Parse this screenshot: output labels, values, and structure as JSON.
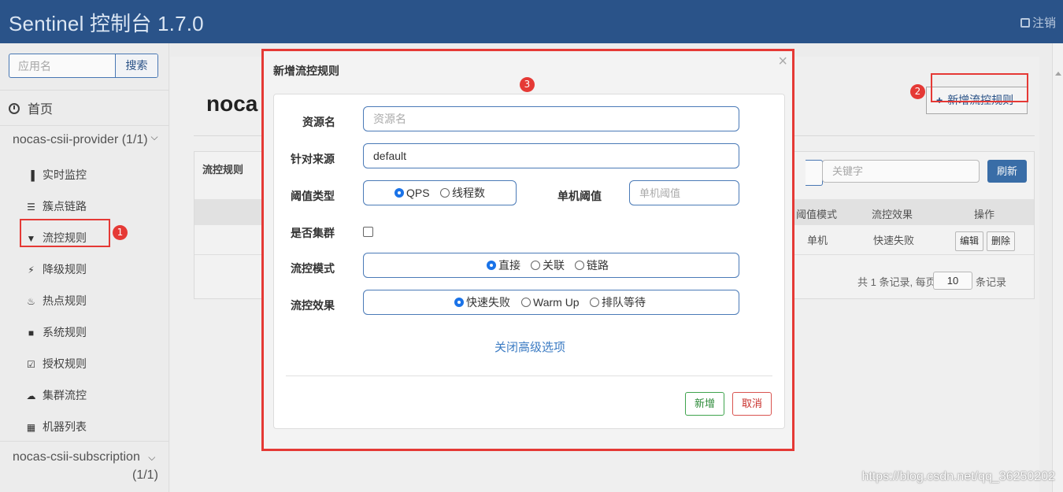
{
  "header": {
    "title": "Sentinel 控制台 1.7.0",
    "logout": "注销"
  },
  "sidebar": {
    "search_placeholder": "应用名",
    "search_button": "搜索",
    "home": "首页",
    "app1": "nocas-csii-provider",
    "app1_count": "(1/1)",
    "items": [
      {
        "label": "实时监控",
        "icon": "bar-chart-icon"
      },
      {
        "label": "簇点链路",
        "icon": "list-icon"
      },
      {
        "label": "流控规则",
        "icon": "filter-icon"
      },
      {
        "label": "降级规则",
        "icon": "bolt-icon"
      },
      {
        "label": "热点规则",
        "icon": "fire-icon"
      },
      {
        "label": "系统规则",
        "icon": "lock-icon"
      },
      {
        "label": "授权规则",
        "icon": "check-square-icon"
      },
      {
        "label": "集群流控",
        "icon": "cloud-icon"
      },
      {
        "label": "机器列表",
        "icon": "th-list-icon"
      }
    ],
    "app2": "nocas-csii-subscription",
    "app2_count": "(1/1)"
  },
  "main": {
    "title_partial": "noca",
    "add_rule_button": "新增流控规则",
    "card_title": "流控规则",
    "keyword_placeholder": "关键字",
    "refresh_button": "刷新",
    "columns": [
      "阈值模式",
      "流控效果",
      "操作"
    ],
    "row": {
      "mode": "单机",
      "effect": "快速失败",
      "edit": "编辑",
      "delete": "删除"
    },
    "pager_prefix": "共 1 条记录, 每页",
    "page_size": "10",
    "pager_suffix": "条记录"
  },
  "modal": {
    "title": "新增流控规则",
    "close": "×",
    "resource_label": "资源名",
    "resource_placeholder": "资源名",
    "origin_label": "针对来源",
    "origin_value": "default",
    "threshold_type_label": "阈值类型",
    "threshold_types": [
      "QPS",
      "线程数"
    ],
    "threshold_type_selected": "QPS",
    "single_threshold_label": "单机阈值",
    "single_threshold_placeholder": "单机阈值",
    "cluster_label": "是否集群",
    "cluster_checked": false,
    "mode_label": "流控模式",
    "modes": [
      "直接",
      "关联",
      "链路"
    ],
    "mode_selected": "直接",
    "effect_label": "流控效果",
    "effects": [
      "快速失败",
      "Warm Up",
      "排队等待"
    ],
    "effect_selected": "快速失败",
    "advanced_link": "关闭高级选项",
    "add_button": "新增",
    "cancel_button": "取消"
  },
  "annotations": {
    "badge1": "1",
    "badge2": "2",
    "badge3": "3",
    "highlight_color": "#e53935"
  },
  "watermark": "https://blog.csdn.net/qq_36250202"
}
